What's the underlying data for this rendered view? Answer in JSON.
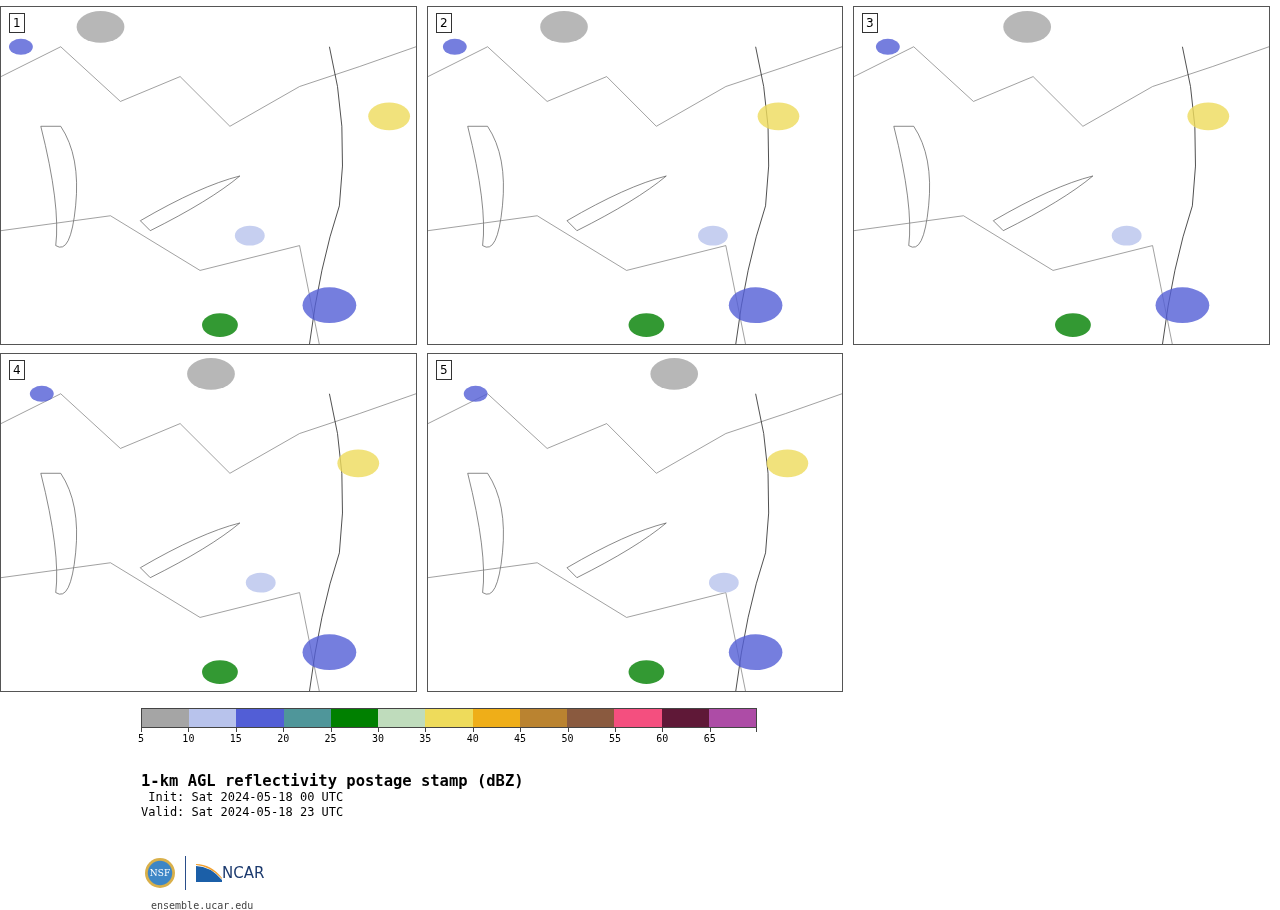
{
  "panels": [
    {
      "label": "1"
    },
    {
      "label": "2"
    },
    {
      "label": "3"
    },
    {
      "label": "4"
    },
    {
      "label": "5"
    }
  ],
  "colorbar": {
    "bins": [
      {
        "tick": "5",
        "color": "#a5a5a5"
      },
      {
        "tick": "10",
        "color": "#b8c3ec"
      },
      {
        "tick": "15",
        "color": "#525ed6"
      },
      {
        "tick": "20",
        "color": "#4f969a"
      },
      {
        "tick": "25",
        "color": "#008000"
      },
      {
        "tick": "30",
        "color": "#bfdcbc"
      },
      {
        "tick": "35",
        "color": "#eedb5b"
      },
      {
        "tick": "40",
        "color": "#efae18"
      },
      {
        "tick": "45",
        "color": "#ba8330"
      },
      {
        "tick": "50",
        "color": "#8a5a3f"
      },
      {
        "tick": "55",
        "color": "#f44f7f"
      },
      {
        "tick": "60",
        "color": "#5f1837"
      },
      {
        "tick": "65",
        "color": "#ad4ca6"
      }
    ]
  },
  "title": "1-km AGL reflectivity postage stamp (dBZ)",
  "init": " Init: Sat 2024-05-18 00 UTC",
  "valid": "Valid: Sat 2024-05-18 23 UTC",
  "logo": {
    "nsf": "NSF",
    "ncar": "NCAR"
  },
  "footer": "ensemble.ucar.edu"
}
